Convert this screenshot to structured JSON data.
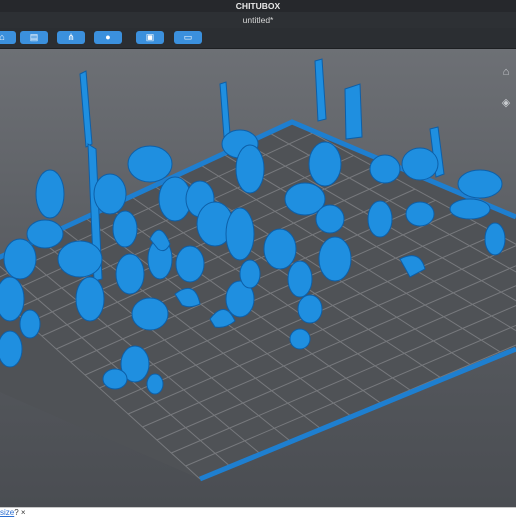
{
  "app": {
    "title": "CHITUBOX",
    "document": "untitled*"
  },
  "toolbar": {
    "buttons": [
      {
        "icon": "open-icon",
        "glyph": "⌂"
      },
      {
        "icon": "file-icon",
        "glyph": "▤"
      },
      {
        "icon": "network-icon",
        "glyph": "⋔"
      },
      {
        "icon": "drop-icon",
        "glyph": "●"
      },
      {
        "icon": "layers-icon",
        "glyph": "▣"
      },
      {
        "icon": "box-icon",
        "glyph": "▭"
      }
    ]
  },
  "nav": {
    "home_glyph": "⌂",
    "view_glyph": "◈"
  },
  "status": {
    "link_text": "size",
    "suffix": "?",
    "close_glyph": "×"
  },
  "colors": {
    "model": "#1f8fe0",
    "plate_edge": "#1e7fd0",
    "grid": "#77797d",
    "accent": "#3b90dd"
  }
}
